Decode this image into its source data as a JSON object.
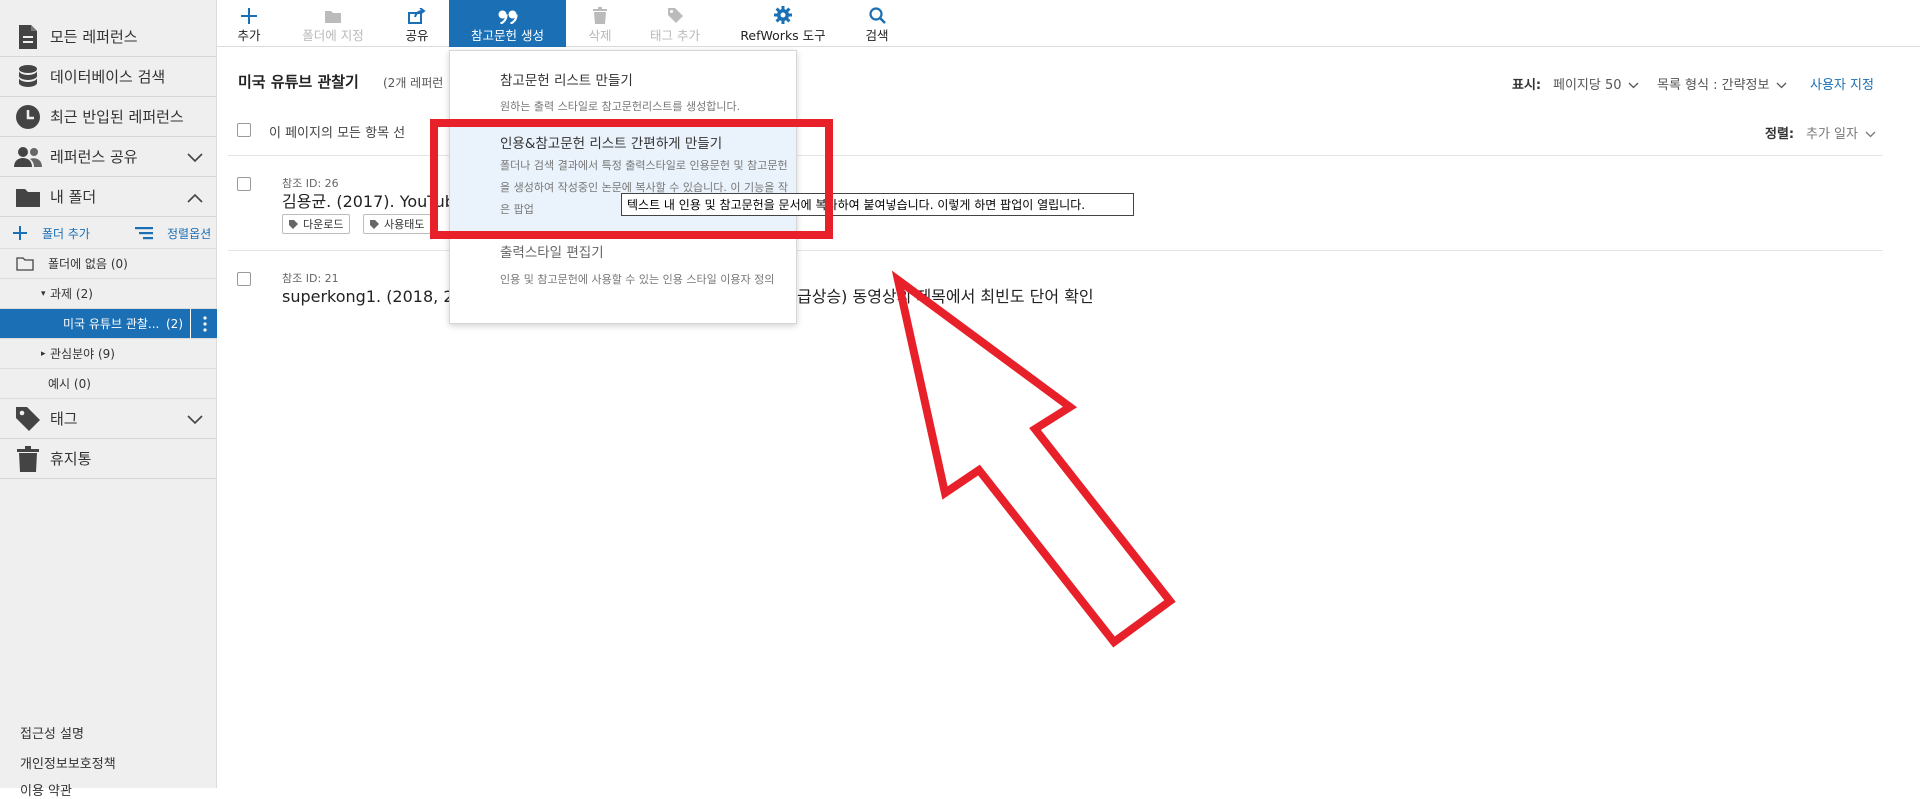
{
  "sidebar": {
    "nav": [
      {
        "label": "모든 레퍼런스",
        "icon": "document-icon"
      },
      {
        "label": "데이터베이스 검색",
        "icon": "database-icon"
      },
      {
        "label": "최근 반입된 레퍼런스",
        "icon": "clock-icon"
      },
      {
        "label": "레퍼런스 공유",
        "icon": "users-icon"
      },
      {
        "label": "내 폴더",
        "icon": "folder-icon"
      }
    ],
    "folder_add": "폴더 추가",
    "sort_options": "정렬옵션",
    "folders": [
      {
        "label": "폴더에 없음 (0)"
      },
      {
        "label": "과제 (2)"
      },
      {
        "label": "미국 유튜브 관찰...",
        "count": "(2)"
      },
      {
        "label": "관심분야 (9)"
      },
      {
        "label": "예시 (0)"
      }
    ],
    "tags": "태그",
    "trash": "휴지통",
    "footer": [
      "접근성 설명",
      "개인정보보호정책",
      "이용 약관"
    ]
  },
  "toolbar": {
    "items": [
      {
        "label": "추가",
        "state": "normal"
      },
      {
        "label": "폴더에 지정",
        "state": "disabled"
      },
      {
        "label": "공유",
        "state": "normal"
      },
      {
        "label": "참고문헌 생성",
        "state": "active"
      },
      {
        "label": "삭제",
        "state": "disabled"
      },
      {
        "label": "태그 추가",
        "state": "disabled"
      },
      {
        "label": "RefWorks 도구",
        "state": "normal"
      },
      {
        "label": "검색",
        "state": "normal"
      }
    ]
  },
  "main": {
    "folder_title": "미국 유튜브 관찰기",
    "folder_count": "(2개 레퍼런",
    "display_label": "표시:",
    "per_page": "페이지당 50",
    "list_format": "목록 형식 : 간략정보",
    "customize": "사용자 지정",
    "select_all": "이 페이지의 모든 항목 선",
    "sort_label": "정렬:",
    "sort_value": "추가 일자",
    "references": [
      {
        "ref_id": "참조 ID: 26",
        "citation": "김용균. (2017). YouTub",
        "tags": [
          "다운로드",
          "사용태도"
        ]
      },
      {
        "ref_id": "참조 ID: 21",
        "citation": "superkong1. (2018, 2월",
        "citation_tail": "급상승) 동영상의 제목에서 최빈도 단어 확인"
      }
    ]
  },
  "dropdown": {
    "items": [
      {
        "title": "참고문헌 리스트 만들기",
        "desc": "원하는 출력 스타일로 참고문헌리스트를 생성합니다."
      },
      {
        "title": "인용&참고문헌 리스트 간편하게 만들기",
        "desc": "폴더나 검색 결과에서 특정 출력스타일로 인용문헌 및 참고문헌을 생성하여 작성중인 논문에 복사할 수 있습니다. 이 기능을 작은 팝업"
      },
      {
        "title": "출력스타일 편집기",
        "desc": "인용 및 참고문헌에 사용할 수 있는 인용 스타일 이용자 정의"
      }
    ]
  },
  "tooltip": "텍스트 내 인용 및 참고문헌을 문서에 복사하여 붙여넣습니다. 이렇게 하면 팝업이 열립니다.",
  "colors": {
    "accent": "#1a6fb5",
    "annotation_red": "#e8202a"
  }
}
